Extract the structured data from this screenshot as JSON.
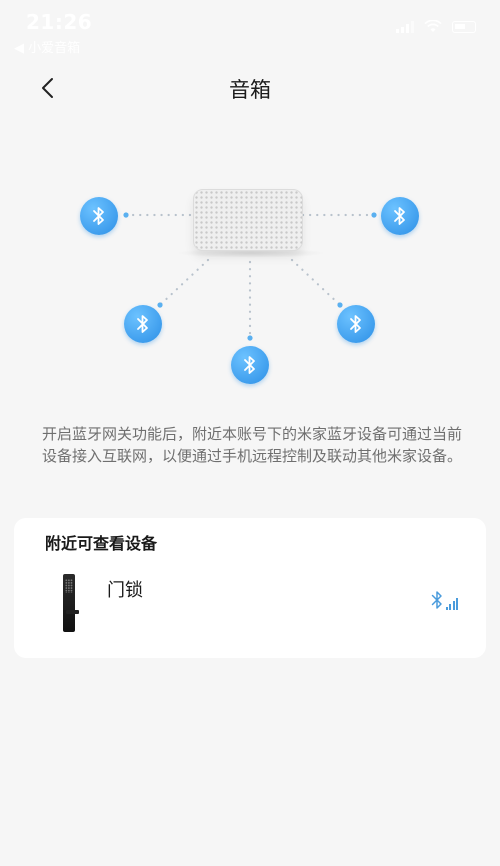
{
  "status_bar": {
    "time": "21:26",
    "back_app": "◀ 小爱音箱"
  },
  "header": {
    "title": "音箱"
  },
  "illustration": {
    "hub": "speaker",
    "node_icon": "bluetooth-icon",
    "node_color": "#3a9ef0"
  },
  "description": "开启蓝牙网关功能后，附近本账号下的米家蓝牙设备可通过当前设备接入互联网，以便通过手机远程控制及联动其他米家设备。",
  "nearby": {
    "title": "附近可查看设备",
    "devices": [
      {
        "name": "门锁",
        "icon": "door-lock-icon",
        "signal_icon": "bluetooth-signal-icon"
      }
    ]
  },
  "colors": {
    "background": "#f6f6f6",
    "accent": "#3a9ef0"
  }
}
